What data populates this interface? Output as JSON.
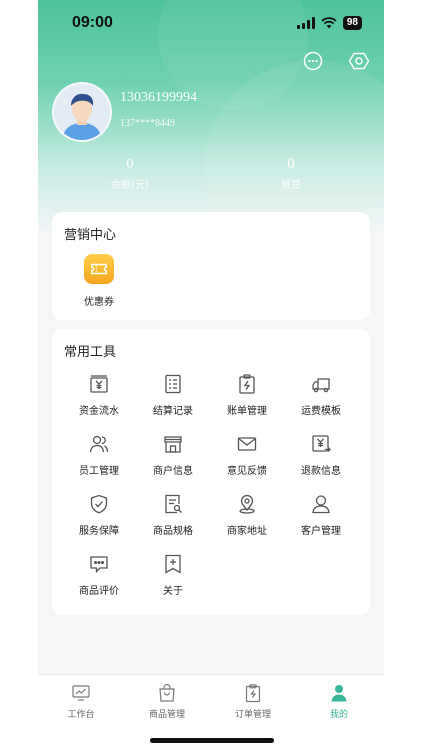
{
  "status_bar": {
    "time": "09:00",
    "battery": "98"
  },
  "header_actions": [
    {
      "name": "message-icon"
    },
    {
      "name": "settings-icon"
    }
  ],
  "user": {
    "phone": "13036199994",
    "masked_phone": "137****8449",
    "avatar_icon": "user-avatar-icon"
  },
  "stats": [
    {
      "value": "0",
      "label": "余额(元)"
    },
    {
      "value": "0",
      "label": "慧豆"
    }
  ],
  "marketing": {
    "title": "营销中心",
    "items": [
      {
        "label": "优惠券",
        "icon": "coupon-icon"
      }
    ]
  },
  "tools": {
    "title": "常用工具",
    "items": [
      {
        "label": "资金流水",
        "icon": "cash-flow-icon"
      },
      {
        "label": "结算记录",
        "icon": "settlement-record-icon"
      },
      {
        "label": "账单管理",
        "icon": "bill-icon"
      },
      {
        "label": "运费模板",
        "icon": "truck-icon"
      },
      {
        "label": "员工管理",
        "icon": "staff-icon"
      },
      {
        "label": "商户信息",
        "icon": "store-icon"
      },
      {
        "label": "意见反馈",
        "icon": "mail-icon"
      },
      {
        "label": "退款信息",
        "icon": "refund-icon"
      },
      {
        "label": "服务保障",
        "icon": "shield-icon"
      },
      {
        "label": "商品规格",
        "icon": "spec-icon"
      },
      {
        "label": "商家地址",
        "icon": "location-icon"
      },
      {
        "label": "客户管理",
        "icon": "customer-icon"
      },
      {
        "label": "商品评价",
        "icon": "review-icon"
      },
      {
        "label": "关于",
        "icon": "about-icon"
      }
    ]
  },
  "tabbar": {
    "active": "我的",
    "accent_color": "#36b59a",
    "items": [
      {
        "label": "工作台",
        "icon": "dashboard-icon"
      },
      {
        "label": "商品管理",
        "icon": "shopping-bag-icon"
      },
      {
        "label": "订单管理",
        "icon": "order-icon"
      },
      {
        "label": "我的",
        "icon": "profile-icon"
      }
    ]
  }
}
